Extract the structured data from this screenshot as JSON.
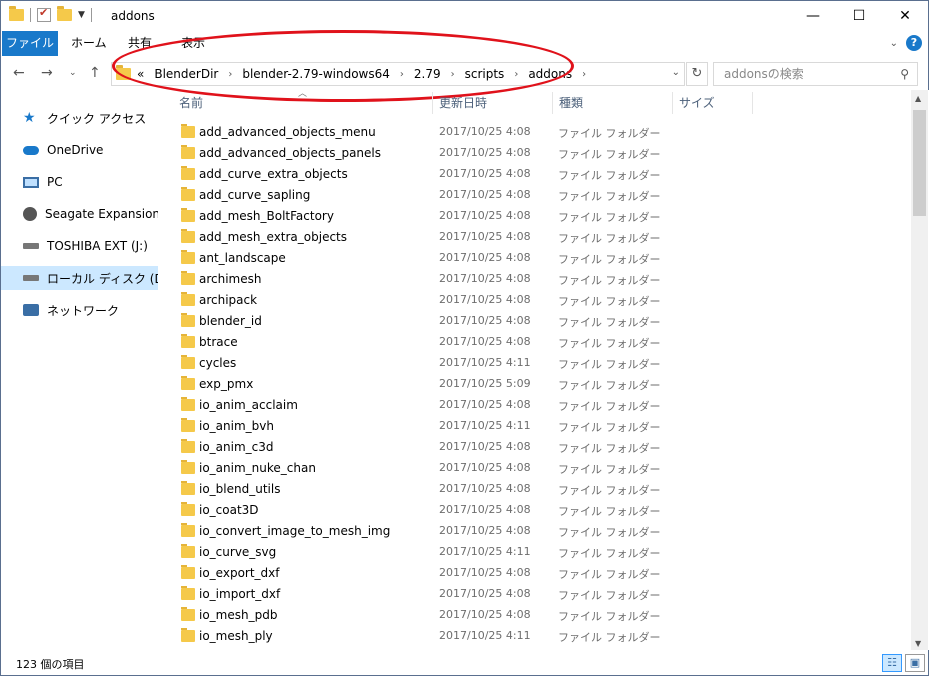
{
  "window": {
    "title": "addons",
    "controls": {
      "minimize": "—",
      "maximize": "☐",
      "close": "✕"
    }
  },
  "ribbon": {
    "tabs": [
      "ファイル",
      "ホーム",
      "共有",
      "表示"
    ]
  },
  "address": {
    "prefix": "«",
    "segments": [
      "BlenderDir",
      "blender-2.79-windows64",
      "2.79",
      "scripts",
      "addons"
    ],
    "search_placeholder": "addonsの検索"
  },
  "sidebar": {
    "items": [
      {
        "label": "クイック アクセス",
        "icon": "star-icon"
      },
      {
        "label": "OneDrive",
        "icon": "cloud-icon"
      },
      {
        "label": "PC",
        "icon": "pc-icon"
      },
      {
        "label": "Seagate Expansion Dr",
        "icon": "hdd-icon"
      },
      {
        "label": "TOSHIBA EXT (J:)",
        "icon": "drive-icon"
      },
      {
        "label": "ローカル ディスク (D:)",
        "icon": "drive-icon",
        "selected": true
      },
      {
        "label": "ネットワーク",
        "icon": "network-icon"
      }
    ]
  },
  "columns": {
    "name": "名前",
    "date": "更新日時",
    "type": "種類",
    "size": "サイズ"
  },
  "files": [
    {
      "name": "add_advanced_objects_menu",
      "date": "2017/10/25 4:08",
      "type": "ファイル フォルダー"
    },
    {
      "name": "add_advanced_objects_panels",
      "date": "2017/10/25 4:08",
      "type": "ファイル フォルダー"
    },
    {
      "name": "add_curve_extra_objects",
      "date": "2017/10/25 4:08",
      "type": "ファイル フォルダー"
    },
    {
      "name": "add_curve_sapling",
      "date": "2017/10/25 4:08",
      "type": "ファイル フォルダー"
    },
    {
      "name": "add_mesh_BoltFactory",
      "date": "2017/10/25 4:08",
      "type": "ファイル フォルダー"
    },
    {
      "name": "add_mesh_extra_objects",
      "date": "2017/10/25 4:08",
      "type": "ファイル フォルダー"
    },
    {
      "name": "ant_landscape",
      "date": "2017/10/25 4:08",
      "type": "ファイル フォルダー"
    },
    {
      "name": "archimesh",
      "date": "2017/10/25 4:08",
      "type": "ファイル フォルダー"
    },
    {
      "name": "archipack",
      "date": "2017/10/25 4:08",
      "type": "ファイル フォルダー"
    },
    {
      "name": "blender_id",
      "date": "2017/10/25 4:08",
      "type": "ファイル フォルダー"
    },
    {
      "name": "btrace",
      "date": "2017/10/25 4:08",
      "type": "ファイル フォルダー"
    },
    {
      "name": "cycles",
      "date": "2017/10/25 4:11",
      "type": "ファイル フォルダー"
    },
    {
      "name": "exp_pmx",
      "date": "2017/10/25 5:09",
      "type": "ファイル フォルダー"
    },
    {
      "name": "io_anim_acclaim",
      "date": "2017/10/25 4:08",
      "type": "ファイル フォルダー"
    },
    {
      "name": "io_anim_bvh",
      "date": "2017/10/25 4:11",
      "type": "ファイル フォルダー"
    },
    {
      "name": "io_anim_c3d",
      "date": "2017/10/25 4:08",
      "type": "ファイル フォルダー"
    },
    {
      "name": "io_anim_nuke_chan",
      "date": "2017/10/25 4:08",
      "type": "ファイル フォルダー"
    },
    {
      "name": "io_blend_utils",
      "date": "2017/10/25 4:08",
      "type": "ファイル フォルダー"
    },
    {
      "name": "io_coat3D",
      "date": "2017/10/25 4:08",
      "type": "ファイル フォルダー"
    },
    {
      "name": "io_convert_image_to_mesh_img",
      "date": "2017/10/25 4:08",
      "type": "ファイル フォルダー"
    },
    {
      "name": "io_curve_svg",
      "date": "2017/10/25 4:11",
      "type": "ファイル フォルダー"
    },
    {
      "name": "io_export_dxf",
      "date": "2017/10/25 4:08",
      "type": "ファイル フォルダー"
    },
    {
      "name": "io_import_dxf",
      "date": "2017/10/25 4:08",
      "type": "ファイル フォルダー"
    },
    {
      "name": "io_mesh_pdb",
      "date": "2017/10/25 4:08",
      "type": "ファイル フォルダー"
    },
    {
      "name": "io_mesh_ply",
      "date": "2017/10/25 4:11",
      "type": "ファイル フォルダー"
    }
  ],
  "status": {
    "count": "123 個の項目"
  },
  "colors": {
    "accent": "#1979ca",
    "selected": "#cce8ff",
    "highlight_ellipse": "#e0121b"
  }
}
